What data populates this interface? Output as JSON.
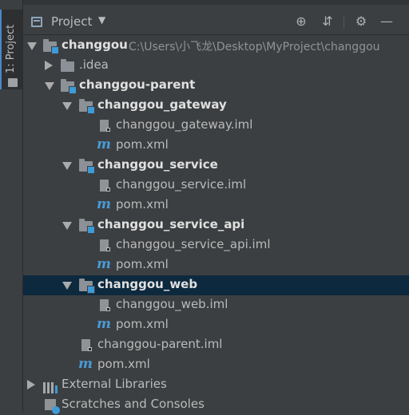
{
  "toolstrip": {
    "tab_label": "1: Project"
  },
  "header": {
    "title": "Project",
    "caret": "▼",
    "buttons": {
      "locate": "⊕",
      "collapse": "⇵",
      "settings": "⚙",
      "hide": "—"
    }
  },
  "tree": {
    "root": {
      "label": "changgou",
      "path": "C:\\Users\\小飞龙\\Desktop\\MyProject\\changgou"
    },
    "idea": {
      "label": ".idea"
    },
    "parent": {
      "label": "changgou-parent"
    },
    "gateway": {
      "label": "changgou_gateway",
      "iml": "changgou_gateway.iml",
      "pom": "pom.xml"
    },
    "service": {
      "label": "changgou_service",
      "iml": "changgou_service.iml",
      "pom": "pom.xml"
    },
    "service_api": {
      "label": "changgou_service_api",
      "iml": "changgou_service_api.iml",
      "pom": "pom.xml"
    },
    "web": {
      "label": "changgou_web",
      "iml": "changgou_web.iml",
      "pom": "pom.xml"
    },
    "parent_iml": {
      "label": "changgou-parent.iml"
    },
    "parent_pom": {
      "label": "pom.xml"
    },
    "external_libraries": {
      "label": "External Libraries"
    },
    "scratches": {
      "label": "Scratches and Consoles"
    }
  },
  "icons": {
    "maven_glyph": "m",
    "colors": {
      "module_badge": "#3d9bd9",
      "selection": "#0d293e",
      "maven": "#4a9bd6"
    }
  }
}
